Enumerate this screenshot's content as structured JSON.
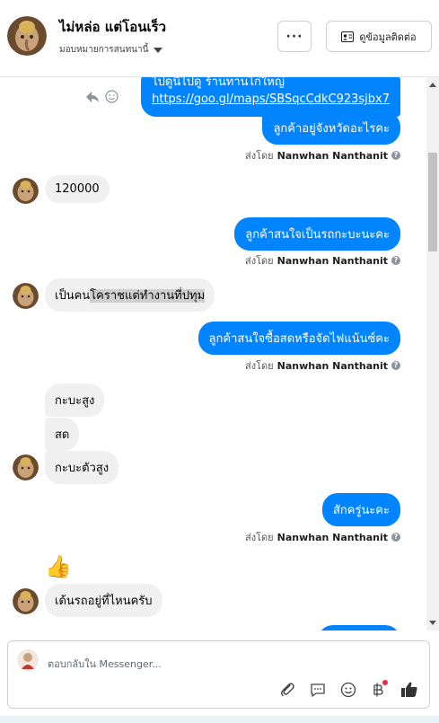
{
  "header": {
    "contact_name": "ไม่หล่อ แต่โอนเร็ว",
    "assign_label": "มอบหมายการสนทนานี้",
    "more_label": "···",
    "contact_info_label": "ดูข้อมูลติดต่อ"
  },
  "messages": {
    "m1_partial": "ไปดูนี่ไปดู ร้านทานไก่ใหญ่",
    "m1_link": "https://goo.gl/maps/SBSqcCdkC923sjbx7",
    "m2": "ลูกค้าอยู่จังหวัดอะไรคะ",
    "m3": "120000",
    "m4": "ลูกค้าสนใจเป็นรถกะบะนะคะ",
    "m5_a": "เป็นคน",
    "m5_b": "โคราชแต่ทำงานที่ปทุม",
    "m6": "ลูกค้าสนใจซื้อสดหรือจัดไฟแน้นซ์คะ",
    "m7": "กะบะสูง",
    "m8": "สด",
    "m9": "กะบะตัวสูง",
    "m10": "สักครู่นะคะ",
    "m11_emoji": "👍",
    "m12": "เด้นรถอยู่ที่ไหนครับ"
  },
  "sent_by": {
    "prefix": "ส่งโดย",
    "name": "Nanwhan Nanthanit"
  },
  "composer": {
    "placeholder": "ตอบกลับใน Messenger..."
  },
  "colors": {
    "outgoing_bubble": "#0084ff",
    "incoming_bubble": "#f0f0f0",
    "notification_dot": "#f02849"
  }
}
